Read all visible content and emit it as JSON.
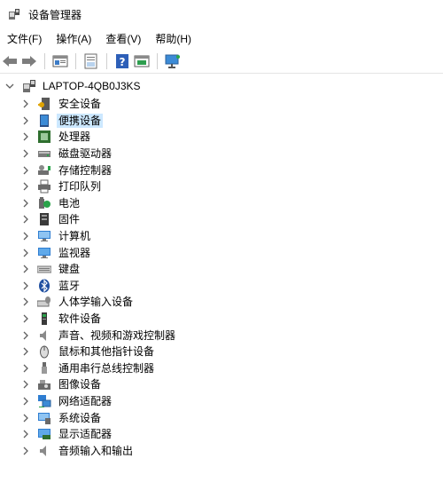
{
  "window": {
    "title": "设备管理器"
  },
  "menu": [
    {
      "label": "文件(F)"
    },
    {
      "label": "操作(A)"
    },
    {
      "label": "查看(V)"
    },
    {
      "label": "帮助(H)"
    }
  ],
  "toolbar": {
    "buttons": [
      "back-icon",
      "forward-icon",
      "properties-icon",
      "update-driver-icon",
      "help-icon",
      "view-icon",
      "scan-icon"
    ]
  },
  "tree": {
    "root": {
      "label": "LAPTOP-4QB0J3KS",
      "icon": "computer-icon"
    },
    "items": [
      {
        "label": "安全设备",
        "icon": "security-device-icon"
      },
      {
        "label": "便携设备",
        "icon": "portable-device-icon",
        "selected": true
      },
      {
        "label": "处理器",
        "icon": "processor-icon"
      },
      {
        "label": "磁盘驱动器",
        "icon": "disk-drive-icon"
      },
      {
        "label": "存储控制器",
        "icon": "storage-controller-icon"
      },
      {
        "label": "打印队列",
        "icon": "print-queue-icon"
      },
      {
        "label": "电池",
        "icon": "battery-icon"
      },
      {
        "label": "固件",
        "icon": "firmware-icon"
      },
      {
        "label": "计算机",
        "icon": "computer-icon"
      },
      {
        "label": "监视器",
        "icon": "monitor-icon"
      },
      {
        "label": "键盘",
        "icon": "keyboard-icon"
      },
      {
        "label": "蓝牙",
        "icon": "bluetooth-icon"
      },
      {
        "label": "人体学输入设备",
        "icon": "hid-icon"
      },
      {
        "label": "软件设备",
        "icon": "software-device-icon"
      },
      {
        "label": "声音、视频和游戏控制器",
        "icon": "speaker-icon"
      },
      {
        "label": "鼠标和其他指针设备",
        "icon": "mouse-icon"
      },
      {
        "label": "通用串行总线控制器",
        "icon": "usb-icon"
      },
      {
        "label": "图像设备",
        "icon": "camera-icon"
      },
      {
        "label": "网络适配器",
        "icon": "network-adapter-icon"
      },
      {
        "label": "系统设备",
        "icon": "system-device-icon"
      },
      {
        "label": "显示适配器",
        "icon": "display-adapter-icon"
      },
      {
        "label": "音频输入和输出",
        "icon": "audio-io-icon"
      }
    ]
  },
  "colors": {
    "selection": "#cce8ff",
    "chevron": "#606060"
  }
}
